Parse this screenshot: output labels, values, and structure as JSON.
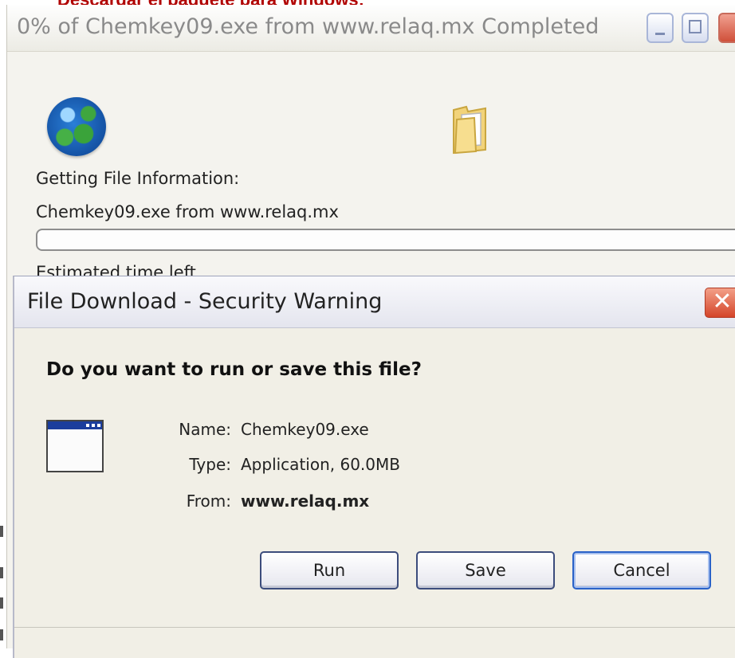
{
  "caption": {
    "text": "Descargar el paquete para Windows;"
  },
  "progress_window": {
    "title": "0% of Chemkey09.exe from www.relaq.mx Completed",
    "getting_info": "Getting File Information:",
    "file_from": "Chemkey09.exe from www.relaq.mx",
    "estimated_time_label": "Estimated time left",
    "progress_percent": 0,
    "icons": [
      "globe-icon",
      "folder-icon"
    ]
  },
  "dialog": {
    "title": "File Download - Security Warning",
    "close_glyph": "✕",
    "question": "Do you want to run or save this file?",
    "fields": {
      "name_label": "Name:",
      "name_value": "Chemkey09.exe",
      "type_label": "Type:",
      "type_value": "Application, 60.0MB",
      "from_label": "From:",
      "from_value": "www.relaq.mx"
    },
    "buttons": {
      "run": "Run",
      "save": "Save",
      "cancel": "Cancel"
    },
    "icon": "application-window-icon"
  },
  "colors": {
    "caption": "#b00000",
    "title_close": "#d4452a",
    "dialog_bg": "#f1efe6",
    "app_icon_bar": "#1b3d9c"
  }
}
